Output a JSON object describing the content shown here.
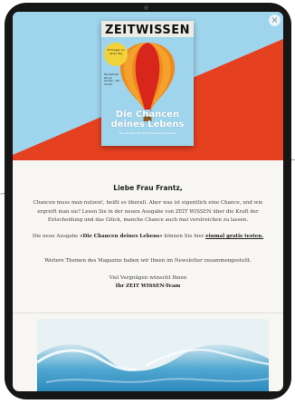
{
  "magazine": {
    "masthead_zeit": "ZEIT",
    "masthead_wissen": "WISSEN",
    "cover_badge": "15 Fragen an einen Tag",
    "cover_side": "Nachgefragt: Wie wir handeln - Neu denken",
    "cover_title": "Die Chancen deines Lebens",
    "cover_subtitle": "Wie wir die Kraft der Entscheidung nutzen",
    "colors": {
      "sky": "#9ed4ec",
      "red": "#e5401f",
      "balloon_orange": "#f18a1d",
      "balloon_red": "#d9261c",
      "cover_title": "#ffffff"
    }
  },
  "close_label": "×",
  "email": {
    "greeting": "Liebe Frau Frantz,",
    "paragraph1": "Chancen muss man nutzen!, heißt es überall. Aber was ist eigentlich eine Chance, und wie ergreift man sie? Lesen Sie in der neuen Ausgabe von ZEIT WISSEN über die Kraft der Entscheidung und das Glück, manche Chance auch mal verstreichen zu lassen.",
    "paragraph2_before": "Die neue Ausgabe ",
    "paragraph2_title": "»Die Chancen deines Lebens«",
    "paragraph2_middle": " können Sie hier ",
    "paragraph2_link": "einmal gratis testen.",
    "paragraph3": "Weitere Themen des Magazins haben wir Ihnen im Newsletter zusammengestellt.",
    "closing": "Viel Vergnügen wünscht Ihnen",
    "signature": "Ihr ZEIT WISSEN-Team"
  },
  "colors": {
    "device_frame": "#161616",
    "email_background": "#f7f6f3",
    "wave_blue": "#1f7fb8"
  }
}
